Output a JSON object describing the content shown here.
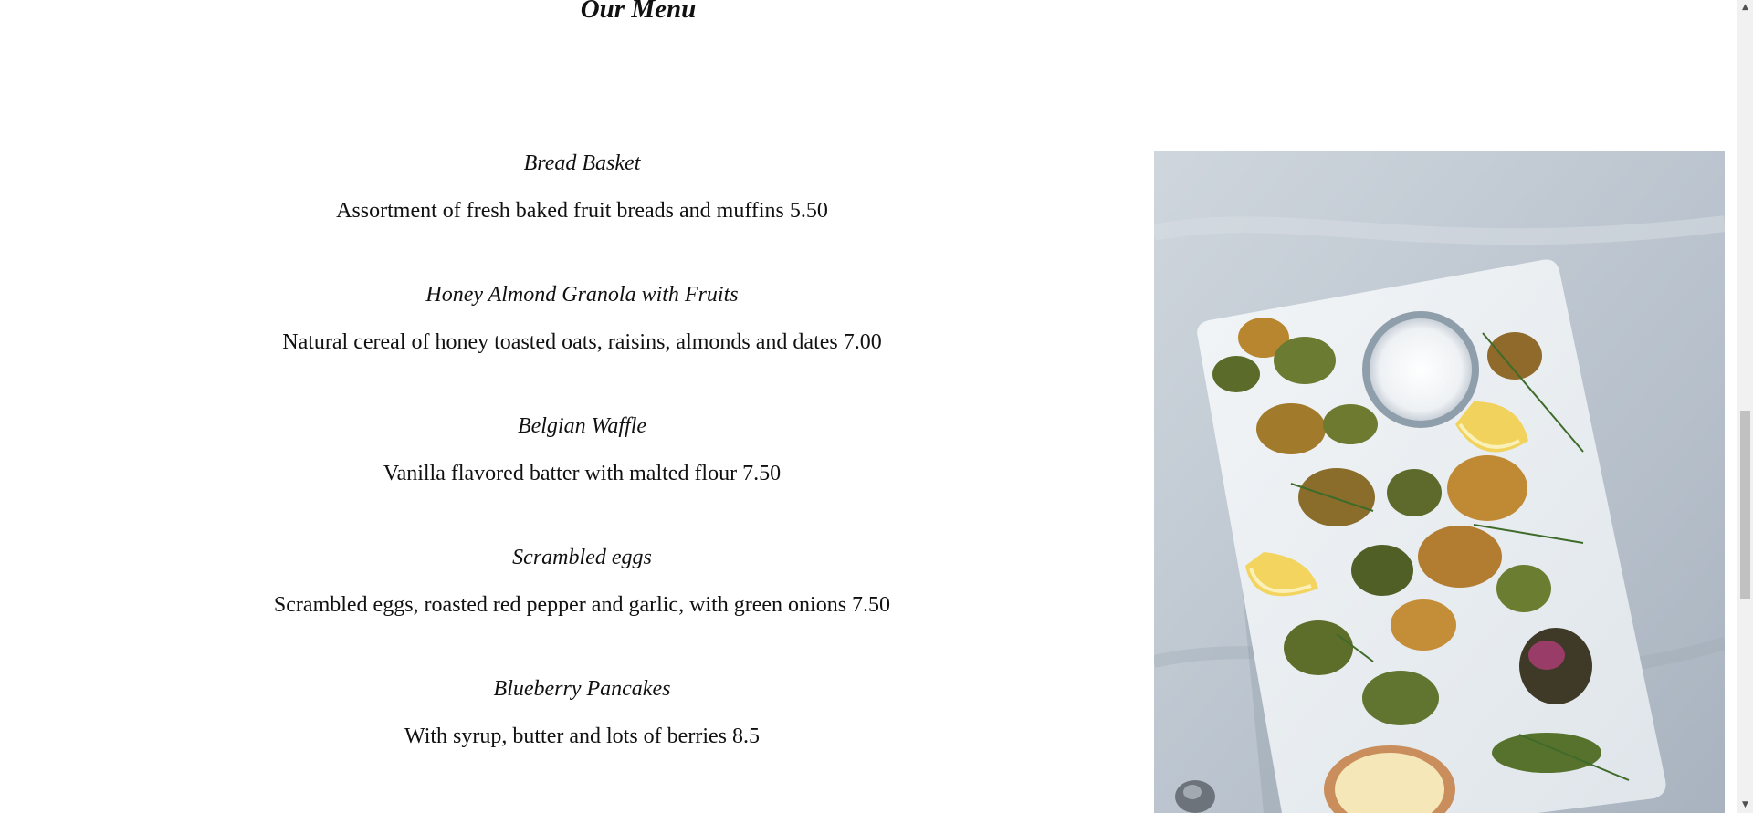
{
  "section": {
    "title": "Our Menu"
  },
  "menu": {
    "items": [
      {
        "name": "Bread Basket",
        "description": "Assortment of fresh baked fruit breads and muffins 5.50"
      },
      {
        "name": "Honey Almond Granola with Fruits",
        "description": "Natural cereal of honey toasted oats, raisins, almonds and dates 7.00"
      },
      {
        "name": "Belgian Waffle",
        "description": "Vanilla flavored batter with malted flour 7.50"
      },
      {
        "name": "Scrambled eggs",
        "description": "Scrambled eggs, roasted red pepper and garlic, with green onions 7.50"
      },
      {
        "name": "Blueberry Pancakes",
        "description": "With syrup, butter and lots of berries 8.5"
      }
    ]
  },
  "image": {
    "subject": "fried vegetable fritters on a white board with lemon wedges, salt bowl and dipping sauce"
  },
  "icons": {
    "scroll_up": "chevron-up-icon",
    "scroll_down": "chevron-down-icon"
  },
  "colors": {
    "text": "#111111",
    "background": "#ffffff"
  }
}
